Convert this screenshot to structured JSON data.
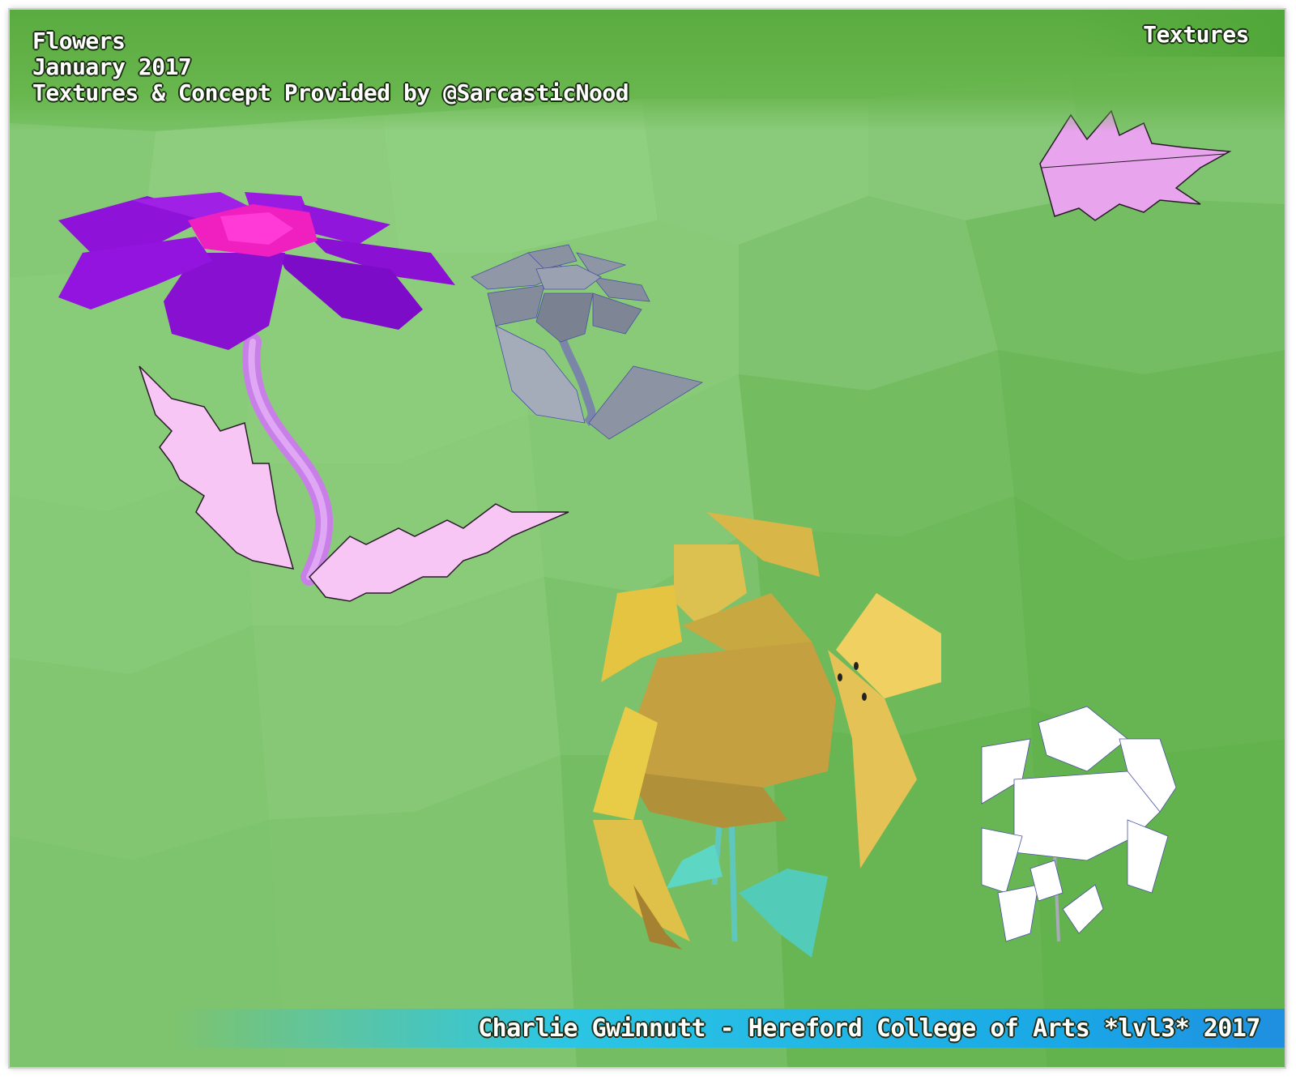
{
  "header": {
    "title": "Flowers",
    "date": "January 2017",
    "credits": "Textures & Concept Provided by @SarcasticNood"
  },
  "section_tag": "Textures",
  "footer": {
    "text": "Charlie Gwinnutt - Hereford College of Arts *lvl3* 2017"
  },
  "colors": {
    "background": "#7ec46c",
    "flower_purple": "#9b1ee6",
    "flower_center": "#f020c8",
    "leaf_pink": "#f6c4f2",
    "lily_yellow": "#e8cc50",
    "stem_teal": "#5ed6c4",
    "wire_gray": "#8e96a6",
    "footer_cyan": "#2cc6e4"
  }
}
